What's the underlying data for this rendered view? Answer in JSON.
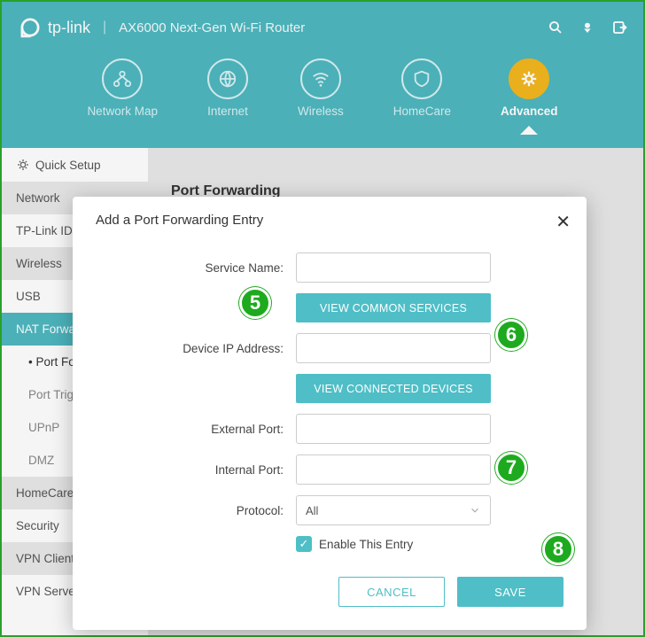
{
  "header": {
    "brand": "tp-link",
    "product": "AX6000 Next-Gen Wi-Fi Router",
    "nav": [
      {
        "label": "Network Map"
      },
      {
        "label": "Internet"
      },
      {
        "label": "Wireless"
      },
      {
        "label": "HomeCare"
      },
      {
        "label": "Advanced",
        "active": true
      }
    ]
  },
  "sidebar": [
    {
      "label": "Quick Setup",
      "head": true
    },
    {
      "label": "Network"
    },
    {
      "label": "TP-Link ID"
    },
    {
      "label": "Wireless"
    },
    {
      "label": "USB"
    },
    {
      "label": "NAT Forwarding",
      "selected": true
    },
    {
      "label": "Port Forwarding",
      "sub": true,
      "active": true
    },
    {
      "label": "Port Triggering",
      "sub": true
    },
    {
      "label": "UPnP",
      "sub": true
    },
    {
      "label": "DMZ",
      "sub": true
    },
    {
      "label": "HomeCare",
      "alt": true
    },
    {
      "label": "Security"
    },
    {
      "label": "VPN Client",
      "alt": true
    },
    {
      "label": "VPN Server"
    }
  ],
  "main": {
    "title": "Port Forwarding"
  },
  "modal": {
    "title": "Add a Port Forwarding Entry",
    "fields": {
      "service_name_label": "Service Name:",
      "view_common": "VIEW COMMON SERVICES",
      "device_ip_label": "Device IP Address:",
      "view_connected": "VIEW CONNECTED DEVICES",
      "external_port_label": "External Port:",
      "internal_port_label": "Internal Port:",
      "protocol_label": "Protocol:",
      "protocol_value": "All",
      "enable_label": "Enable This Entry"
    },
    "actions": {
      "cancel": "CANCEL",
      "save": "SAVE"
    }
  },
  "steps": {
    "s5": "5",
    "s6": "6",
    "s7": "7",
    "s8": "8"
  }
}
